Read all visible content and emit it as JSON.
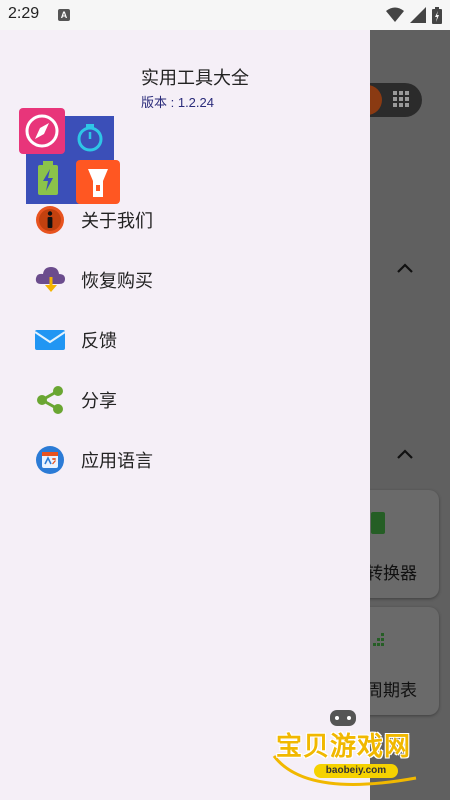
{
  "status_bar": {
    "time": "2:29",
    "notification_letter": "A"
  },
  "drawer": {
    "app_title": "实用工具大全",
    "version": "版本 : 1.2.24",
    "menu_items": [
      {
        "label": "关于我们",
        "icon": "info-icon"
      },
      {
        "label": "恢复购买",
        "icon": "restore-purchase-icon"
      },
      {
        "label": "反馈",
        "icon": "mail-icon"
      },
      {
        "label": "分享",
        "icon": "share-icon"
      },
      {
        "label": "应用语言",
        "icon": "language-icon"
      }
    ]
  },
  "background_app": {
    "card_labels": [
      "转换器",
      "周期表"
    ]
  },
  "watermark": {
    "text": "宝贝游戏网",
    "url": "baobeiy.com"
  },
  "colors": {
    "drawer_bg": "#f5eff7",
    "version_text": "#2a2b7a",
    "scrim": "#606060",
    "watermark_yellow": "#f1b800"
  }
}
